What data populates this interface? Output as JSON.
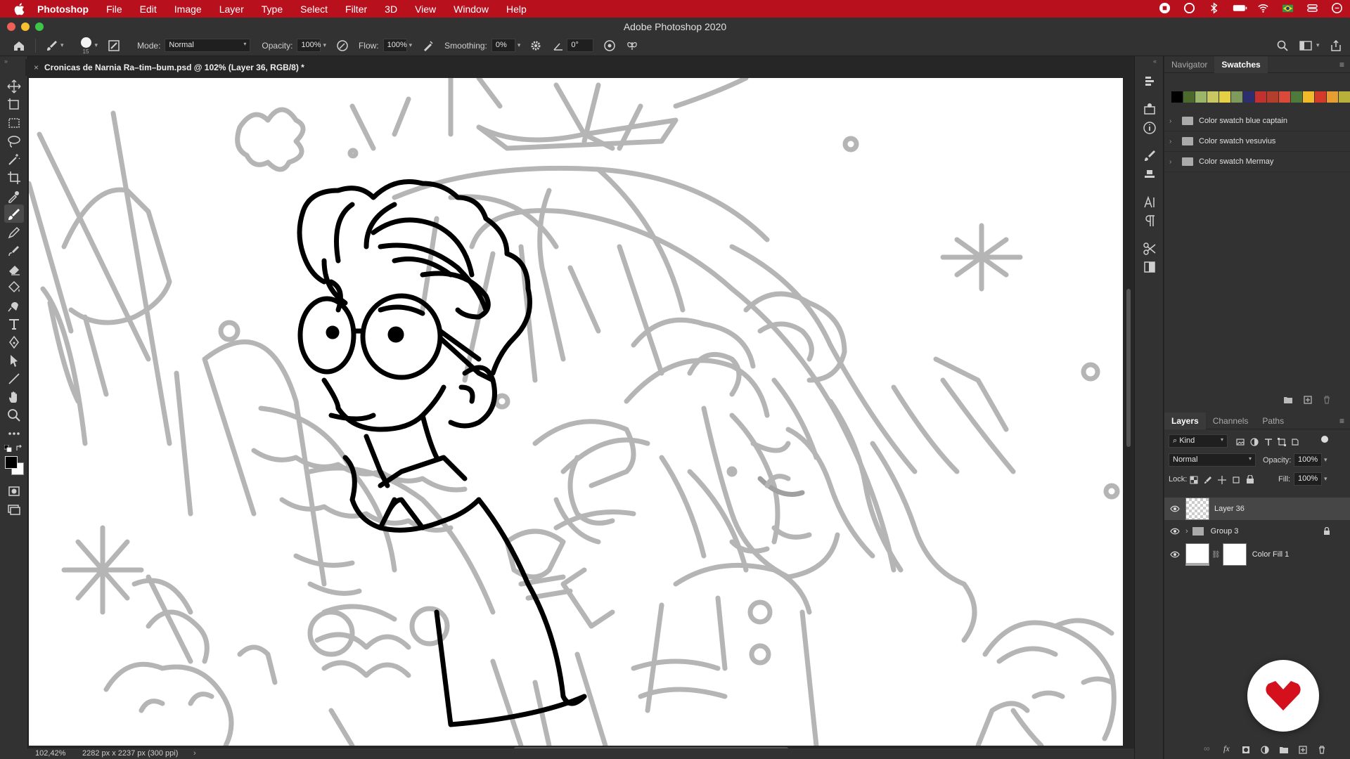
{
  "menubar": {
    "items": [
      "Photoshop",
      "File",
      "Edit",
      "Image",
      "Layer",
      "Type",
      "Select",
      "Filter",
      "3D",
      "View",
      "Window",
      "Help"
    ],
    "bg": "#b8101d"
  },
  "window": {
    "title": "Adobe Photoshop 2020"
  },
  "options": {
    "brush_size": "15",
    "mode_label": "Mode:",
    "mode_value": "Normal",
    "opacity_label": "Opacity:",
    "opacity_value": "100%",
    "flow_label": "Flow:",
    "flow_value": "100%",
    "smoothing_label": "Smoothing:",
    "smoothing_value": "0%",
    "angle_value": "0°"
  },
  "document": {
    "tab_title": "Cronicas de Narnia Ra–tim–bum.psd @ 102% (Layer 36, RGB/8) *"
  },
  "status": {
    "zoom": "102,42%",
    "dimensions": "2282 px x 2237 px (300 ppi)"
  },
  "swatches_panel": {
    "tabs": [
      "Navigator",
      "Swatches"
    ],
    "active_tab": "Swatches",
    "colors": [
      "#000000",
      "#4a6a2c",
      "#9bb56a",
      "#c8c760",
      "#e5cf44",
      "#7f9a5d",
      "#2d2e6e",
      "#c33030",
      "#b23f2b",
      "#d94a38",
      "#4e7a3c",
      "#f2b928",
      "#d43a2c",
      "#e79d2f",
      "#b7b03a",
      "#8cb654"
    ],
    "groups": [
      "Color swatch blue captain",
      "Color swatch vesuvius",
      "Color swatch Mermay"
    ]
  },
  "layers_panel": {
    "tabs": [
      "Layers",
      "Channels",
      "Paths"
    ],
    "active_tab": "Layers",
    "filter_kind": "Kind",
    "blend_mode": "Normal",
    "opacity_label": "Opacity:",
    "opacity_value": "100%",
    "lock_label": "Lock:",
    "fill_label": "Fill:",
    "fill_value": "100%",
    "layers": [
      {
        "name": "Layer 36",
        "selected": true
      },
      {
        "name": "Group 3",
        "selected": false
      },
      {
        "name": "Color Fill 1",
        "selected": false
      }
    ]
  }
}
